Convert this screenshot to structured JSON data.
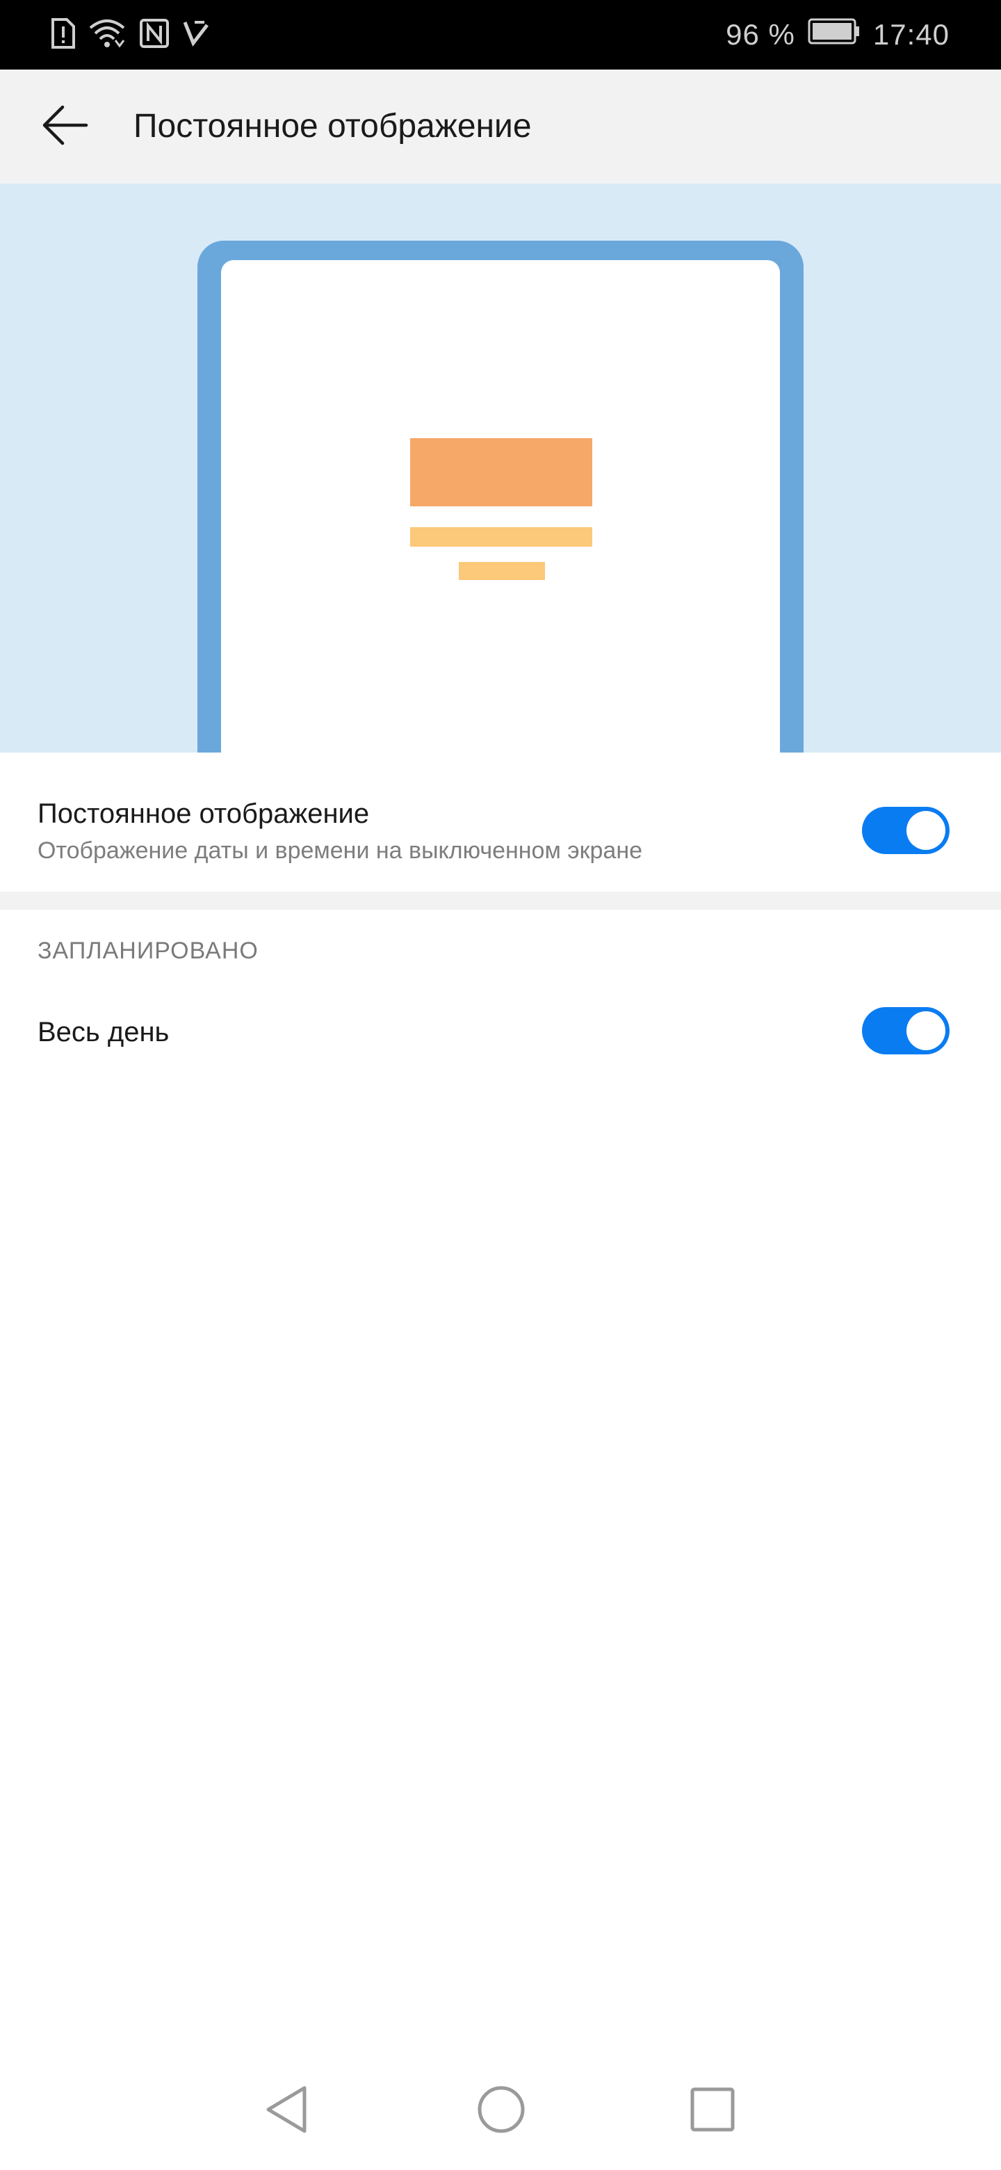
{
  "status_bar": {
    "battery_percent": "96 %",
    "time": "17:40",
    "icons": [
      "alert-sim-icon",
      "wifi-icon",
      "nfc-icon",
      "data-signal-icon",
      "battery-icon"
    ]
  },
  "toolbar": {
    "back_icon": "arrow-left-icon",
    "title": "Постоянное отображение"
  },
  "preview": {
    "frame_color": "#6aa8dc",
    "background_color": "#d9eaf7",
    "block_color": "#f6a868",
    "line_color": "#fcc879"
  },
  "settings": {
    "always_on": {
      "title": "Постоянное отображение",
      "subtitle": "Отображение даты и времени на выключенном экране",
      "enabled": true
    },
    "section_header": "ЗАПЛАНИРОВАНО",
    "all_day": {
      "title": "Весь день",
      "enabled": true
    },
    "toggle_color": "#0a7cf2"
  },
  "nav_bar": {
    "buttons": [
      "nav-back-icon",
      "nav-home-icon",
      "nav-recents-icon"
    ]
  }
}
